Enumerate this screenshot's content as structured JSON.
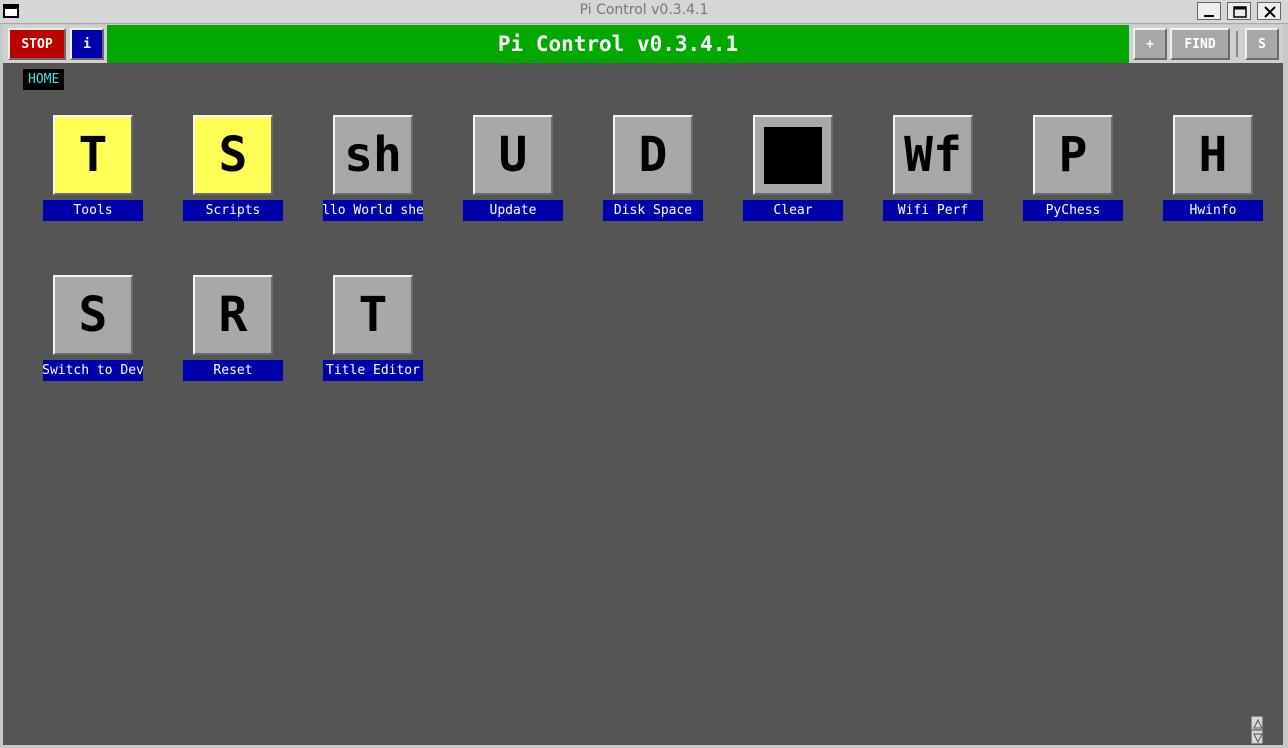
{
  "window": {
    "title": "Pi Control v0.3.4.1",
    "controls": [
      "minimize-icon",
      "maximize-icon",
      "close-icon"
    ]
  },
  "toolbar": {
    "stop_label": "STOP",
    "info_label": "i",
    "banner_title": "Pi Control v0.3.4.1",
    "plus_label": "+",
    "find_label": "FIND",
    "s_label": "S"
  },
  "breadcrumb": {
    "label": "HOME"
  },
  "tiles": [
    {
      "glyph": "T",
      "label": "Tools",
      "style": "yellow"
    },
    {
      "glyph": "S",
      "label": "Scripts",
      "style": "yellow"
    },
    {
      "glyph": "sh",
      "label": "llo World she",
      "style": "gray"
    },
    {
      "glyph": "U",
      "label": "Update",
      "style": "gray"
    },
    {
      "glyph": "D",
      "label": "Disk Space",
      "style": "gray"
    },
    {
      "glyph": "",
      "label": "Clear",
      "style": "gray-black-square"
    },
    {
      "glyph": "Wf",
      "label": "Wifi Perf",
      "style": "gray"
    },
    {
      "glyph": "P",
      "label": "PyChess",
      "style": "gray"
    },
    {
      "glyph": "H",
      "label": "Hwinfo",
      "style": "gray"
    },
    {
      "glyph": "S",
      "label": "Switch to Dev",
      "style": "gray"
    },
    {
      "glyph": "R",
      "label": "Reset",
      "style": "gray"
    },
    {
      "glyph": "T",
      "label": "Title Editor",
      "style": "gray"
    }
  ],
  "colors": {
    "background": "#555555",
    "banner": "#00a800",
    "stop": "#bb0000",
    "info": "#0000aa",
    "tile_label": "#0000aa",
    "tile_yellow": "#ffff55",
    "tile_gray": "#a8a8a8",
    "breadcrumb_text": "#40e0e0"
  }
}
